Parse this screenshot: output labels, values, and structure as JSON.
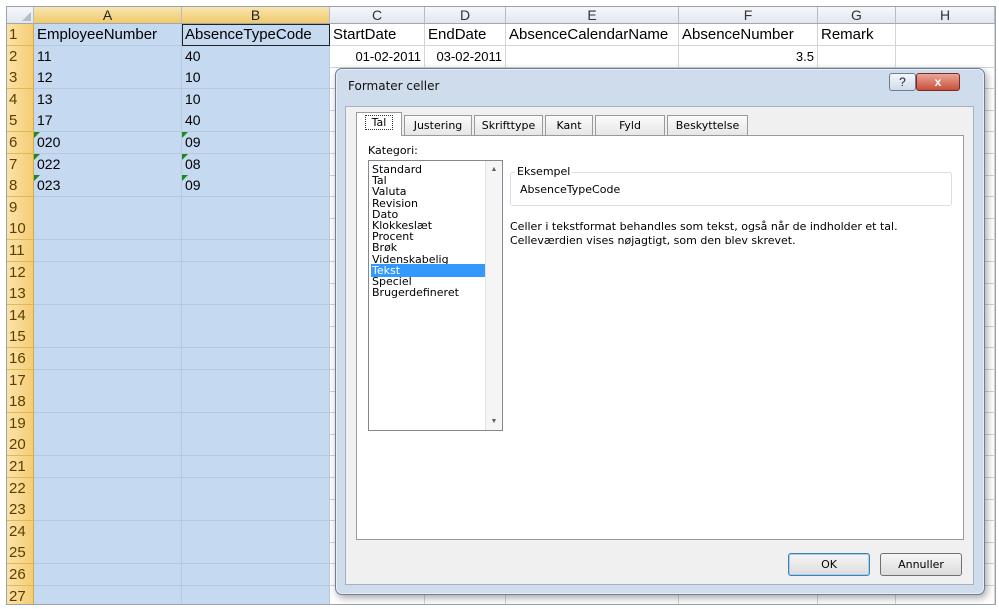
{
  "spreadsheet": {
    "columns": [
      "A",
      "B",
      "C",
      "D",
      "E",
      "F",
      "G",
      "H"
    ],
    "header_row": [
      "EmployeeNumber",
      "AbsenceTypeCode",
      "StartDate",
      "EndDate",
      "AbsenceCalendarName",
      "AbsenceNumber",
      "Remark",
      ""
    ],
    "row_numbers": [
      "1",
      "2",
      "3",
      "4",
      "5",
      "6",
      "7",
      "8",
      "9",
      "10",
      "11",
      "12",
      "13",
      "14",
      "15",
      "16",
      "17",
      "18",
      "19",
      "20",
      "21",
      "22",
      "23",
      "24",
      "25",
      "26",
      "27"
    ],
    "data_rows": [
      {
        "a": "11",
        "b": "40",
        "c": "01-02-2011",
        "d": "03-02-2011",
        "f": "3.5"
      },
      {
        "a": "12",
        "b": "10"
      },
      {
        "a": "13",
        "b": "10"
      },
      {
        "a": "17",
        "b": "40"
      },
      {
        "a": "020",
        "b": "09"
      },
      {
        "a": "022",
        "b": "08"
      },
      {
        "a": "023",
        "b": "09"
      }
    ]
  },
  "dialog": {
    "title": "Formater celler",
    "help_button": "?",
    "close_button": "x",
    "tabs": [
      "Tal",
      "Justering",
      "Skrifttype",
      "Kant",
      "Fyld",
      "Beskyttelse"
    ],
    "active_tab": "Tal",
    "category_label": "Kategori:",
    "categories": [
      "Standard",
      "Tal",
      "Valuta",
      "Revision",
      "Dato",
      "Klokkeslæt",
      "Procent",
      "Brøk",
      "Videnskabelig",
      "Tekst",
      "Speciel",
      "Brugerdefineret"
    ],
    "selected_category": "Tekst",
    "sample_legend": "Eksempel",
    "sample_value": "AbsenceTypeCode",
    "description_line1": "Celler i tekstformat behandles som tekst, også når de indholder et tal.",
    "description_line2": "Celleværdien vises nøjagtigt, som den blev skrevet.",
    "ok_label": "OK",
    "cancel_label": "Annuller"
  }
}
